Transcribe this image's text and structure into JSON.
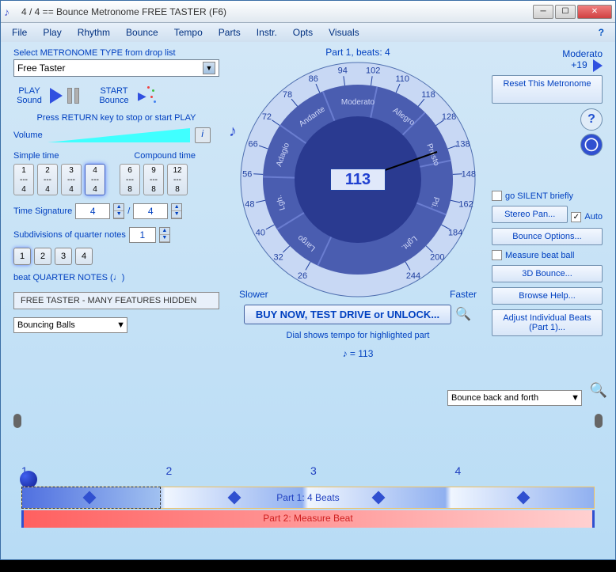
{
  "window": {
    "title": "4 / 4 == Bounce Metronome FREE TASTER  (F6)"
  },
  "menu": [
    "File",
    "Play",
    "Rhythm",
    "Bounce",
    "Tempo",
    "Parts",
    "Instr.",
    "Opts",
    "Visuals"
  ],
  "help_char": "?",
  "left": {
    "select_label": "Select METRONOME TYPE from drop list",
    "select_value": "Free Taster",
    "play_sound": "PLAY Sound",
    "start_bounce": "START Bounce",
    "return_text": "Press RETURN key to stop or start PLAY",
    "volume": "Volume",
    "simple": "Simple time",
    "compound": "Compound time",
    "simple_btns": [
      "1",
      "2",
      "3",
      "4"
    ],
    "simple_denom": "4",
    "compound_btns": [
      "6",
      "9",
      "12"
    ],
    "compound_denom": "8",
    "selected_simple": 3,
    "ts_label": "Time Signature",
    "ts_num": "4",
    "ts_slash": "/",
    "ts_den": "4",
    "sub_label": "Subdivisions of quarter notes",
    "sub_value": "1",
    "sub_btns": [
      "1",
      "2",
      "3",
      "4"
    ],
    "sub_selected": 0,
    "beat_text": "beat  QUARTER NOTES (♩)",
    "feat_box": "FREE TASTER - MANY FEATURES HIDDEN",
    "bouncing": "Bouncing Balls"
  },
  "dial": {
    "part_label": "Part 1, beats: 4",
    "bpm": "113",
    "slower": "Slower",
    "faster": "Faster",
    "buy": "BUY NOW, TEST DRIVE or UNLOCK...",
    "note": "Dial shows tempo for highlighted part",
    "eq": "♪ = 113",
    "outer_numbers": [
      "26",
      "32",
      "40",
      "48",
      "56",
      "66",
      "72",
      "78",
      "86",
      "94",
      "102",
      "110",
      "118",
      "128",
      "138",
      "148",
      "162",
      "184",
      "200",
      "244"
    ],
    "inner_words": [
      "Largo",
      "Lgh.",
      "Adagio",
      "Andante",
      "Moderato",
      "Allegro",
      "Presto",
      "Pti.",
      "Lght."
    ]
  },
  "right": {
    "moderato": "Moderato",
    "plus": "+19",
    "reset": "Reset This Metronome",
    "silent": "go SILENT briefly",
    "stereo": "Stereo Pan...",
    "auto": "Auto",
    "auto_checked": "✓",
    "bounce_opts": "Bounce Options...",
    "measure": "Measure beat ball",
    "d3": "3D Bounce...",
    "browse": "Browse Help...",
    "adjust": "Adjust Individual Beats (Part 1)...",
    "bounce_back": "Bounce back and forth"
  },
  "track": {
    "beats": [
      "1",
      "2",
      "3",
      "4"
    ],
    "part1": "Part 1: 4 Beats",
    "part2": "Part 2: Measure Beat"
  },
  "chart_data": {
    "type": "gauge",
    "title": "Tempo dial",
    "value": 113,
    "label": "Moderato +19",
    "outer_scale": [
      26,
      32,
      40,
      48,
      56,
      66,
      72,
      78,
      86,
      94,
      102,
      110,
      118,
      128,
      138,
      148,
      162,
      184,
      200,
      244
    ],
    "inner_scale": [
      "Largo",
      "Lgh.",
      "Adagio",
      "Andante",
      "Moderato",
      "Allegro",
      "Presto",
      "Pti.",
      "Lght."
    ]
  }
}
